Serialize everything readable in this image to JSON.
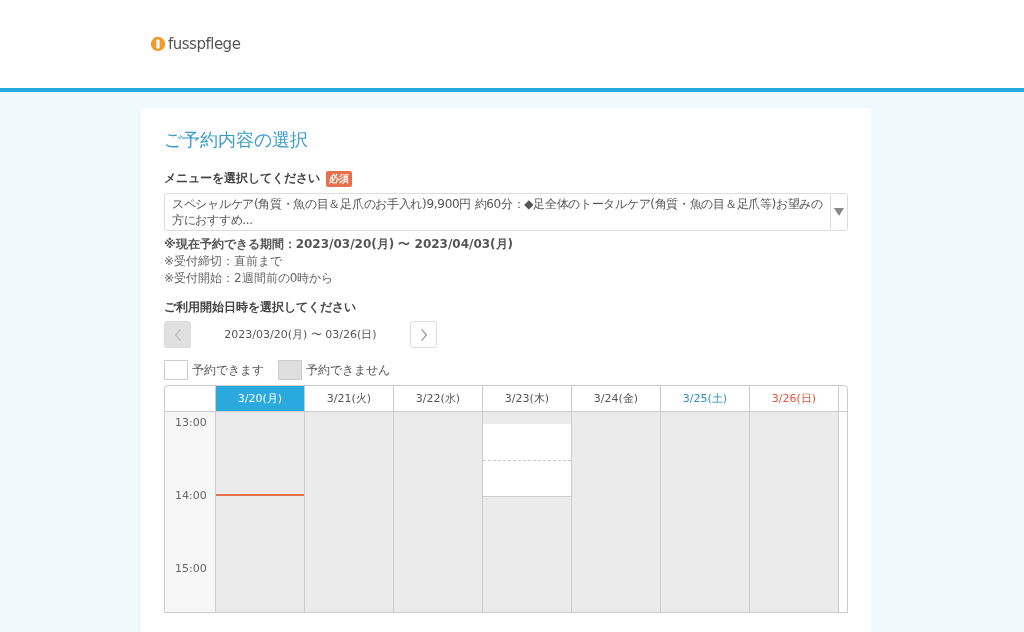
{
  "logo": {
    "text": "fusspflege"
  },
  "page_title": "ご予約内容の選択",
  "menu": {
    "label": "メニューを選択してください",
    "badge": "必須",
    "value": "スペシャルケア(角質・魚の目＆足爪のお手入れ)9,900円 約60分：◆足全体のトータルケア(角質・魚の目＆足爪等)お望みの方におすすめ..."
  },
  "notes": [
    {
      "text": "※現在予約できる期間：2023/03/20(月) 〜 2023/04/03(月)",
      "bold": true
    },
    {
      "text": "※受付締切：直前まで",
      "bold": false
    },
    {
      "text": "※受付開始：2週間前の0時から",
      "bold": false
    }
  ],
  "date_section": {
    "label": "ご利用開始日時を選択してください",
    "range": "2023/03/20(月) 〜 03/26(日)",
    "prev_disabled": true,
    "next_disabled": false
  },
  "legend": [
    {
      "label": "予約できます",
      "available": true
    },
    {
      "label": "予約できません",
      "available": false
    }
  ],
  "calendar": {
    "times": [
      "13:00",
      "14:00",
      "15:00"
    ],
    "days": [
      {
        "label": "3/20(月)",
        "selected": true,
        "color": "#ffffff",
        "now_line": true,
        "slots": [
          {
            "available": false
          },
          {
            "available": false
          },
          {
            "available": false
          },
          {
            "available": false
          },
          {
            "available": false
          }
        ]
      },
      {
        "label": "3/21(火)",
        "selected": false,
        "color": "#555555",
        "now_line": false,
        "slots": [
          {
            "available": false
          },
          {
            "available": false
          },
          {
            "available": false
          },
          {
            "available": false
          },
          {
            "available": false
          }
        ]
      },
      {
        "label": "3/22(水)",
        "selected": false,
        "color": "#555555",
        "now_line": false,
        "slots": [
          {
            "available": false
          },
          {
            "available": false
          },
          {
            "available": false
          },
          {
            "available": false
          },
          {
            "available": false
          }
        ]
      },
      {
        "label": "3/23(木)",
        "selected": false,
        "color": "#555555",
        "now_line": false,
        "slots": [
          {
            "available": true
          },
          {
            "available": true
          },
          {
            "available": false
          },
          {
            "available": false
          },
          {
            "available": false
          }
        ]
      },
      {
        "label": "3/24(金)",
        "selected": false,
        "color": "#555555",
        "now_line": false,
        "slots": [
          {
            "available": false
          },
          {
            "available": false
          },
          {
            "available": false
          },
          {
            "available": false
          },
          {
            "available": false
          }
        ]
      },
      {
        "label": "3/25(土)",
        "selected": false,
        "color": "#2a8fc0",
        "now_line": false,
        "slots": [
          {
            "available": false
          },
          {
            "available": false
          },
          {
            "available": false
          },
          {
            "available": false
          },
          {
            "available": false
          }
        ]
      },
      {
        "label": "3/26(日)",
        "selected": false,
        "color": "#e0553a",
        "now_line": false,
        "slots": [
          {
            "available": false
          },
          {
            "available": false
          },
          {
            "available": false
          },
          {
            "available": false
          },
          {
            "available": false
          }
        ]
      }
    ]
  }
}
